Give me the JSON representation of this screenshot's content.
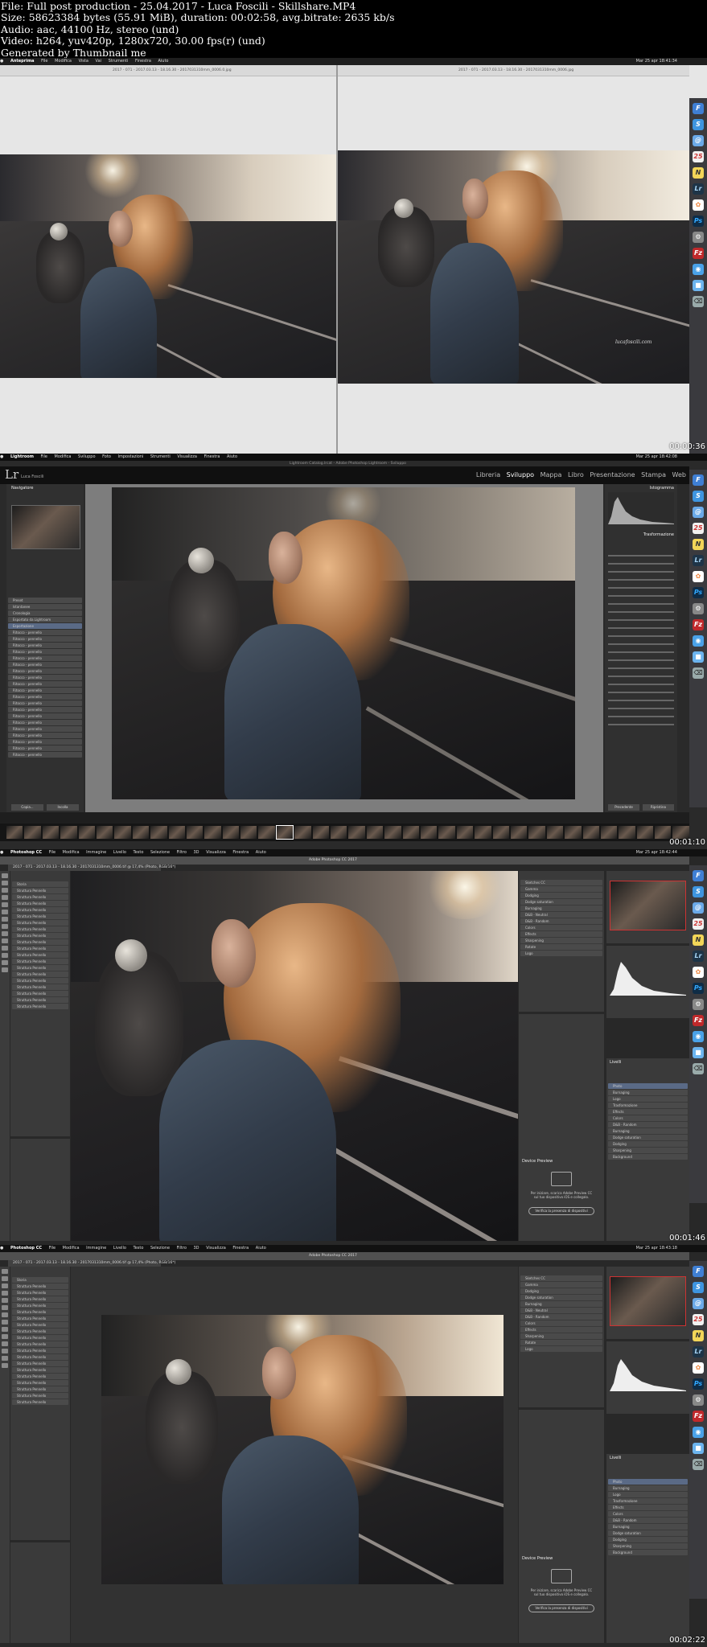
{
  "header": {
    "line1": "File: Full post production - 25.04.2017 - Luca Foscili - Skillshare.MP4",
    "line2": "Size: 58623384 bytes (55.91 MiB), duration: 00:02:58, avg.bitrate: 2635 kb/s",
    "line3": "Audio: aac, 44100 Hz, stereo (und)",
    "line4": "Video: h264, yuv420p, 1280x720, 30.00 fps(r) (und)",
    "line5": "Generated by Thumbnail me"
  },
  "frame1": {
    "menu": {
      "app": "Anteprima",
      "items": [
        "File",
        "Modifica",
        "Vista",
        "Vai",
        "Strumenti",
        "Finestra",
        "Aiuto"
      ],
      "clock": "Mar 25 apr 18:41:34"
    },
    "left_title": "2017 - 071 - 2017.03.13 - 18.16.30 - 2017031310mm_0006.0.jpg",
    "right_title": "2017 - 071 - 2017.03.13 - 18.16.30 - 2017031310mm_0006.jpg",
    "watermark": "lucafoscili.com",
    "timestamp": "00:00:36"
  },
  "frame2": {
    "menu": {
      "app": "Lightroom",
      "items": [
        "File",
        "Modifica",
        "Sviluppo",
        "Foto",
        "Impostazioni",
        "Strumenti",
        "Visualizza",
        "Finestra",
        "Aiuto"
      ],
      "clock": "Mar 25 apr 18:42:08"
    },
    "window_title": "Lightroom Catalog.lrcat - Adobe Photoshop Lightroom - Sviluppo",
    "brand": "Lr",
    "brand_sub": "Luca Foscili",
    "modules": [
      "Libreria",
      "Sviluppo",
      "Mappa",
      "Libro",
      "Presentazione",
      "Stampa",
      "Web"
    ],
    "active_module": "Sviluppo",
    "left_panel_title": "Navigatore",
    "left_rows": [
      "Preset",
      "Istantanee",
      "Cronologia",
      "Esportato da Lightroom",
      "Esportazione",
      "Ritocco - pennello",
      "Ritocco - pennello",
      "Ritocco - pennello",
      "Ritocco - pennello",
      "Ritocco - pennello",
      "Ritocco - pennello",
      "Ritocco - pennello",
      "Ritocco - pennello",
      "Ritocco - pennello",
      "Ritocco - pennello",
      "Ritocco - pennello",
      "Ritocco - pennello",
      "Ritocco - pennello",
      "Ritocco - pennello",
      "Ritocco - pennello",
      "Ritocco - pennello",
      "Ritocco - pennello",
      "Ritocco - pennello",
      "Ritocco - pennello",
      "Ritocco - pennello"
    ],
    "selected_row": 4,
    "right_panel_title": "Istogramma",
    "right_section": "Trasformazione",
    "bottom_left": [
      "Copia...",
      "Incolla"
    ],
    "bottom_right": [
      "Precedente",
      "Ripristina"
    ],
    "timestamp": "00:01:10"
  },
  "frame3": {
    "menu": {
      "app": "Photoshop CC",
      "items": [
        "File",
        "Modifica",
        "Immagine",
        "Livello",
        "Testo",
        "Selezione",
        "Filtro",
        "3D",
        "Visualizza",
        "Finestra",
        "Aiuto"
      ],
      "clock": "Mar 25 apr 18:42:44"
    },
    "window_title": "Adobe Photoshop CC 2017",
    "doc_tab": "2017 - 071 - 2017.03.13 - 18.16.30 - 2017031310mm_0006.tif @ 17,4% (Photo, RGB/16*)",
    "history_rows": [
      "Storia",
      "Struttura Pennello",
      "Struttura Pennello",
      "Struttura Pennello",
      "Struttura Pennello",
      "Struttura Pennello",
      "Struttura Pennello",
      "Struttura Pennello",
      "Struttura Pennello",
      "Struttura Pennello",
      "Struttura Pennello",
      "Struttura Pennello",
      "Struttura Pennello",
      "Struttura Pennello",
      "Struttura Pennello",
      "Struttura Pennello",
      "Struttura Pennello",
      "Struttura Pennello",
      "Struttura Pennello",
      "Struttura Pennello"
    ],
    "actions": [
      "Sketches CC",
      "Gamma",
      "Dodging",
      "Dodge saturation",
      "Burnaging",
      "D&B - Neutral",
      "D&B - Random",
      "Colors",
      "Effects",
      "Sharpening",
      "Rotate",
      "Logo"
    ],
    "layers_header": "Livelli",
    "layers": [
      "Photo",
      "Burnaging",
      "Logo",
      "Trasformazione",
      "Effects",
      "Colors",
      "D&B - Random",
      "Burnaging",
      "Dodge saturation",
      "Dodging",
      "Sharpening",
      "Background"
    ],
    "device_preview_title": "Device Preview",
    "device_preview_text": "Per iniziare, scarica Adobe Preview CC sul tuo dispositivo iOS e collegalo.",
    "device_preview_button": "Verifica la presenza di dispositivi",
    "timestamp": "00:01:46"
  },
  "frame4": {
    "menu": {
      "app": "Photoshop CC",
      "items": [
        "File",
        "Modifica",
        "Immagine",
        "Livello",
        "Testo",
        "Selezione",
        "Filtro",
        "3D",
        "Visualizza",
        "Finestra",
        "Aiuto"
      ],
      "clock": "Mar 25 apr 18:43:18"
    },
    "window_title": "Adobe Photoshop CC 2017",
    "doc_tab": "2017 - 071 - 2017.03.13 - 18.16.30 - 2017031310mm_0006.tif @ 17,4% (Photo, RGB/16*)",
    "timestamp": "00:02:22"
  }
}
